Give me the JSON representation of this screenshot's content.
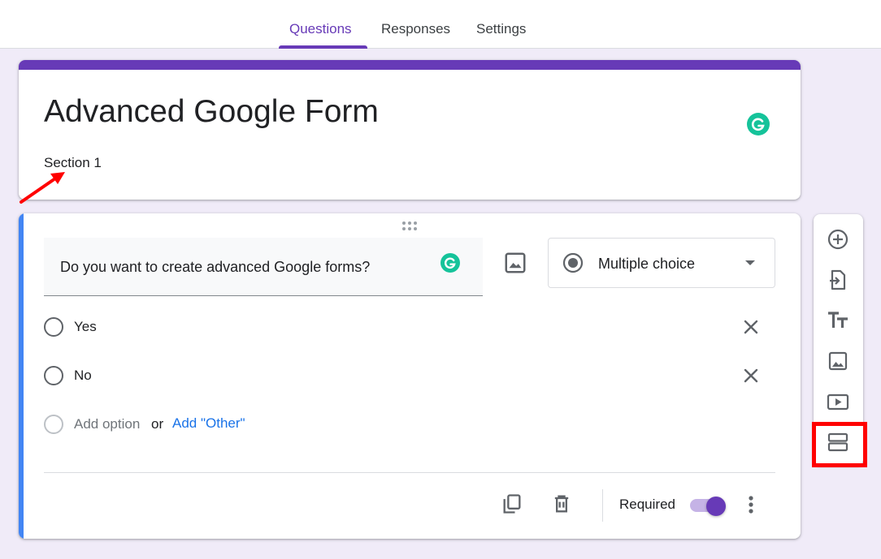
{
  "tabs": [
    {
      "label": "Questions",
      "active": true
    },
    {
      "label": "Responses",
      "active": false
    },
    {
      "label": "Settings",
      "active": false
    }
  ],
  "form": {
    "title": "Advanced Google Form",
    "section": "Section 1"
  },
  "question": {
    "text": "Do you want to create advanced Google forms?",
    "type": "Multiple choice",
    "options": [
      "Yes",
      "No"
    ],
    "add_option": "Add option",
    "or": "or",
    "add_other": "Add \"Other\"",
    "required_label": "Required",
    "required": true
  },
  "toolbar": {
    "items": [
      "add-question-icon",
      "import-questions-icon",
      "add-title-icon",
      "add-image-icon",
      "add-video-icon",
      "add-section-icon"
    ]
  },
  "colors": {
    "accent": "#673ab7",
    "question_bar": "#4285f4",
    "grammarly": "#15c39a",
    "highlight": "#ff0000",
    "link": "#1a73e8"
  }
}
